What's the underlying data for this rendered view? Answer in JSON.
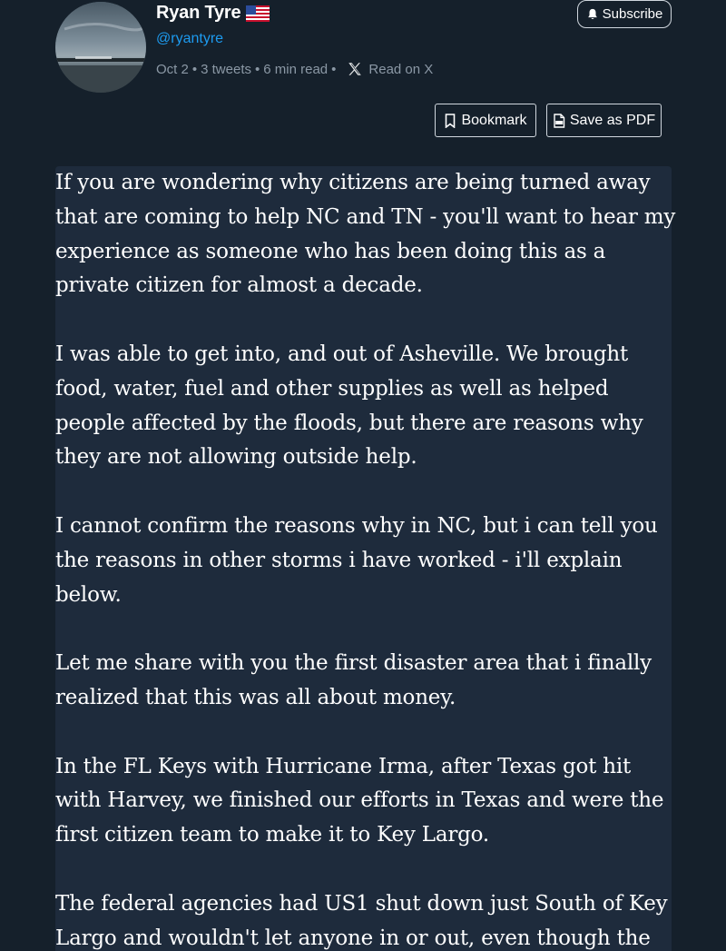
{
  "author": {
    "name": "Ryan Tyre",
    "flag_icon": "us-flag-icon",
    "handle": "@ryantyre"
  },
  "meta": {
    "date": "Oct 2",
    "tweets": "3 tweets",
    "read_time": "6 min read",
    "separator": "•",
    "read_on_x": "Read on X"
  },
  "actions": {
    "subscribe_label": "Subscribe",
    "bookmark_label": "Bookmark",
    "save_pdf_label": "Save as PDF"
  },
  "article": {
    "paragraphs": [
      "If you are wondering why citizens are being turned away that are coming to help NC and TN - you'll want to hear my experience as someone who has been doing this as a private citizen for almost a decade.",
      "I was able to get into, and out of Asheville. We brought food, water, fuel and other supplies as well as helped people affected by the floods, but there are reasons why they are not allowing outside help.",
      "I cannot confirm the reasons why in NC, but i can tell you the reasons in other storms i have worked - i'll explain below.",
      "Let me share with you the first disaster area that i finally realized that this was all about money.",
      "In the FL Keys with Hurricane Irma, after Texas got hit with Harvey, we finished our efforts in Texas and were the first citizen team to make it to Key Largo.",
      "The federal agencies had US1 shut down just South of Key Largo and wouldn't let anyone in or out, even though the"
    ]
  },
  "colors": {
    "background": "#15202b",
    "article_background": "#1e2b3c",
    "handle": "#1d9bf0",
    "meta": "#8b98a5"
  }
}
